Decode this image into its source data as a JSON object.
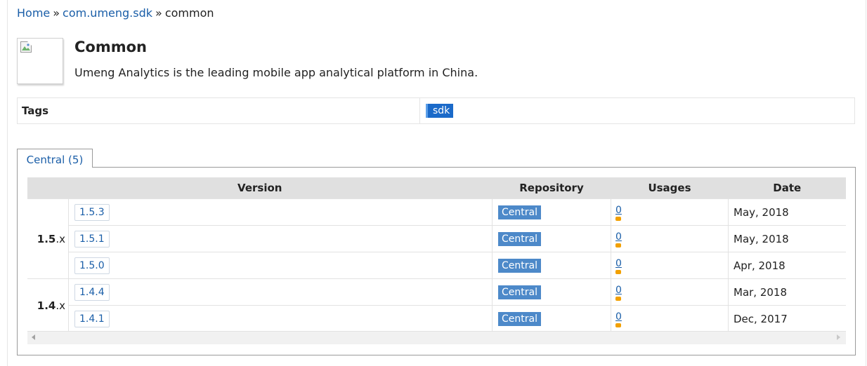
{
  "breadcrumb": {
    "home": "Home",
    "sep1": "»",
    "group": "com.umeng.sdk",
    "sep2": "»",
    "current": "common"
  },
  "artifact": {
    "title": "Common",
    "description": "Umeng Analytics is the leading mobile app analytical platform in China.",
    "logo_icon": "broken-image-icon"
  },
  "tags": {
    "label": "Tags",
    "items": [
      "sdk"
    ]
  },
  "tab": {
    "label": "Central (5)"
  },
  "table": {
    "headers": {
      "version": "Version",
      "repository": "Repository",
      "usages": "Usages",
      "date": "Date"
    },
    "groups": [
      {
        "major": "1.5",
        "suffix": ".x",
        "rows": [
          {
            "version": "1.5.3",
            "repository": "Central",
            "usages": "0",
            "date": "May, 2018"
          },
          {
            "version": "1.5.1",
            "repository": "Central",
            "usages": "0",
            "date": "May, 2018"
          },
          {
            "version": "1.5.0",
            "repository": "Central",
            "usages": "0",
            "date": "Apr, 2018"
          }
        ]
      },
      {
        "major": "1.4",
        "suffix": ".x",
        "rows": [
          {
            "version": "1.4.4",
            "repository": "Central",
            "usages": "0",
            "date": "Mar, 2018"
          },
          {
            "version": "1.4.1",
            "repository": "Central",
            "usages": "0",
            "date": "Dec, 2017"
          }
        ]
      }
    ]
  },
  "colors": {
    "link": "#1a5ea8",
    "tag_bg": "#1b6ac9",
    "repo_badge_bg": "#4d89c9",
    "usage_bar": "#f2a000",
    "header_bg": "#e0e0e0"
  }
}
